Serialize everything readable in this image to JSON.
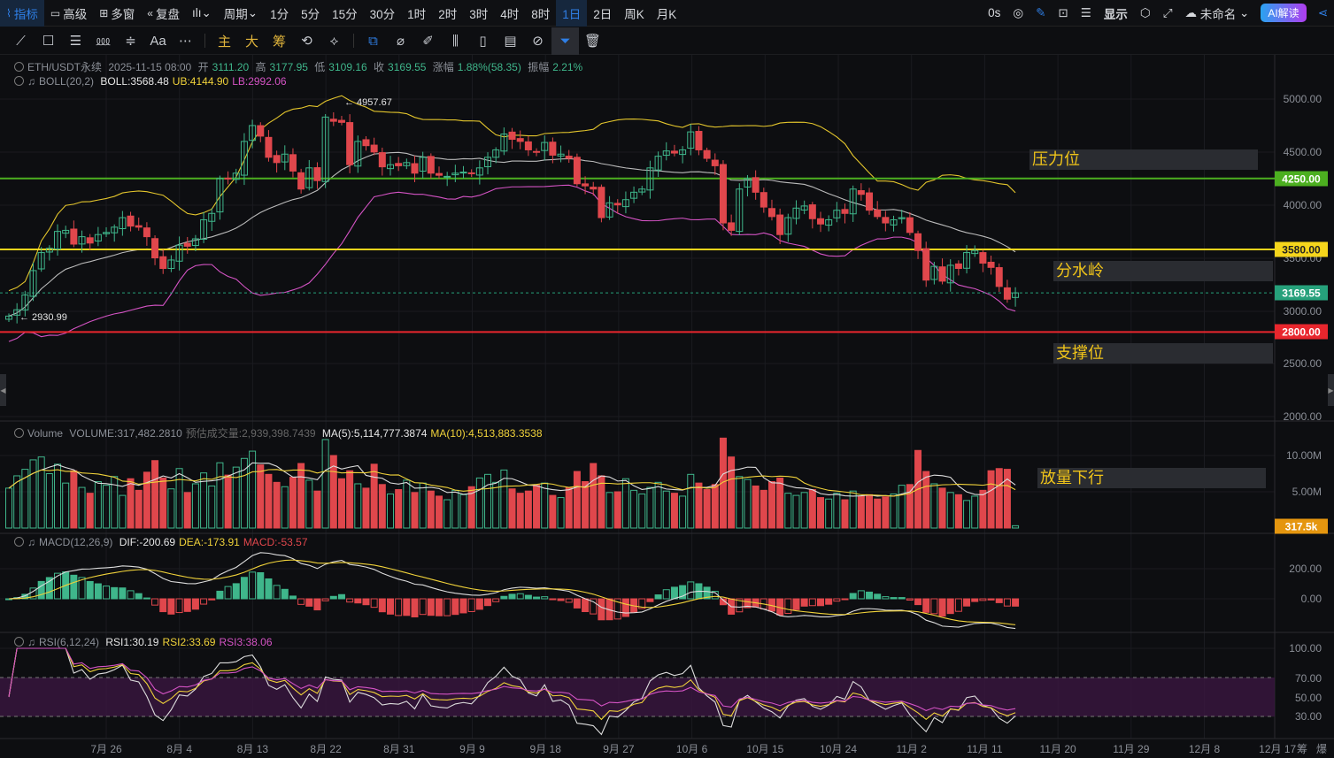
{
  "toolbar": {
    "indicators": "指标",
    "advanced": "高级",
    "multi_window": "多窗",
    "replay": "复盘",
    "period": "周期",
    "intervals": [
      "1分",
      "5分",
      "15分",
      "30分",
      "1时",
      "2时",
      "3时",
      "4时",
      "8时",
      "1日",
      "2日",
      "周K",
      "月K"
    ],
    "active_interval": "1日",
    "countdown": "0s",
    "display": "显示",
    "layout_name": "未命名",
    "ai_button": "AI解读"
  },
  "drawing_tools": {
    "text_tool": "Aa",
    "main": "主",
    "big": "大",
    "chips": "筹"
  },
  "info": {
    "symbol": "ETH/USDT永续",
    "datetime": "2025-11-15 08:00",
    "open_label": "开",
    "open": "3111.20",
    "high_label": "高",
    "high": "3177.95",
    "low_label": "低",
    "low": "3109.16",
    "close_label": "收",
    "close": "3169.55",
    "change_label": "涨幅",
    "change": "1.88%(58.35)",
    "amplitude_label": "振幅",
    "amplitude": "2.21%",
    "boll_name": "BOLL(20,2)",
    "boll": "BOLL:3568.48",
    "ub": "UB:4144.90",
    "lb": "LB:2992.06",
    "vol_name": "Volume",
    "volume": "VOLUME:317,482.2810",
    "est_volume": "预估成交量:2,939,398.7439",
    "vol_ma5": "MA(5):5,114,777.3874",
    "vol_ma10": "MA(10):4,513,883.3538",
    "macd_name": "MACD(12,26,9)",
    "dif": "DIF:-200.69",
    "dea": "DEA:-173.91",
    "macd": "MACD:-53.57",
    "rsi_name": "RSI(6,12,24)",
    "rsi1": "RSI1:30.19",
    "rsi2": "RSI2:33.69",
    "rsi3": "RSI3:38.06"
  },
  "markers": {
    "high": "← 4957.67",
    "low": "← 2930.99"
  },
  "annotations": {
    "resistance": "压力位",
    "watershed": "分水岭",
    "support": "支撑位",
    "volume_down": "放量下行"
  },
  "price_axis": [
    "5000.00",
    "4500.00",
    "4000.00",
    "3500.00",
    "3000.00",
    "2500.00",
    "2000.00"
  ],
  "volume_axis": [
    "10.00M",
    "5.00M"
  ],
  "macd_axis": [
    "200.00",
    "0.00"
  ],
  "rsi_axis": [
    "100.00",
    "70.00",
    "50.00",
    "30.00"
  ],
  "tags": {
    "resistance": "4250.00",
    "watershed": "3580.00",
    "last": "3169.55",
    "support": "2800.00",
    "volume": "317.5k"
  },
  "x_axis": [
    "7月 26",
    "8月 4",
    "8月 13",
    "8月 22",
    "8月 31",
    "9月 9",
    "9月 18",
    "9月 27",
    "10月 6",
    "10月 15",
    "10月 24",
    "11月 2",
    "11月 11",
    "11月 20",
    "11月 29",
    "12月 8",
    "12月 17"
  ],
  "x_axis_extra": [
    "筹",
    "爆"
  ],
  "colors": {
    "up": "#3fb68b",
    "down": "#e0474c",
    "resistance": "#4caf20",
    "watershed": "#f5d51c",
    "support": "#e8262d",
    "last": "#26a17b",
    "vol_tag": "#e5960f"
  },
  "chart_data": {
    "type": "candlestick",
    "title": "ETH/USDT永续 1日",
    "start_date": "2025-07-14",
    "levels": {
      "resistance": 4250,
      "watershed": 3580,
      "support": 2800
    },
    "close": [
      2950,
      3010,
      3150,
      3380,
      3550,
      3590,
      3750,
      3760,
      3630,
      3700,
      3640,
      3720,
      3740,
      3790,
      3880,
      3800,
      3790,
      3700,
      3500,
      3400,
      3480,
      3620,
      3610,
      3680,
      3860,
      3920,
      4250,
      4250,
      4300,
      4600,
      4750,
      4650,
      4450,
      4400,
      4480,
      4320,
      4150,
      4350,
      4230,
      4830,
      4790,
      4780,
      4380,
      4600,
      4560,
      4500,
      4360,
      4380,
      4370,
      4400,
      4300,
      4450,
      4300,
      4280,
      4270,
      4300,
      4310,
      4300,
      4350,
      4450,
      4520,
      4670,
      4620,
      4600,
      4520,
      4500,
      4590,
      4470,
      4480,
      4440,
      4200,
      4180,
      4150,
      3880,
      4020,
      4000,
      4050,
      4120,
      4150,
      4350,
      4460,
      4510,
      4490,
      4520,
      4690,
      4520,
      4440,
      4370,
      3830,
      3760,
      4150,
      4250,
      4120,
      3980,
      3890,
      3720,
      3880,
      3970,
      3990,
      3870,
      3820,
      3860,
      3950,
      3920,
      4150,
      4100,
      3950,
      3890,
      3830,
      3860,
      3880,
      3740,
      3570,
      3290,
      3420,
      3280,
      3430,
      3400,
      3550,
      3570,
      3450,
      3410,
      3230,
      3110,
      3169.55
    ],
    "volume_m": [
      5.5,
      7.2,
      8.1,
      9.4,
      9.8,
      7.5,
      8.8,
      6.2,
      7.9,
      5.6,
      4.8,
      6.4,
      5.9,
      7.1,
      4.5,
      6.8,
      5.2,
      7.7,
      9.3,
      6.9,
      5.4,
      8.2,
      4.9,
      6.1,
      7.6,
      5.8,
      9.0,
      7.3,
      8.4,
      9.6,
      10.6,
      8.7,
      7.4,
      6.3,
      5.7,
      7.0,
      8.9,
      6.6,
      5.1,
      12.2,
      10.0,
      6.8,
      7.9,
      6.1,
      5.5,
      8.8,
      6.0,
      4.7,
      5.3,
      6.6,
      4.9,
      6.2,
      5.1,
      4.4,
      3.9,
      5.2,
      4.6,
      5.7,
      6.9,
      7.4,
      6.3,
      8.0,
      5.4,
      4.8,
      5.1,
      5.9,
      6.2,
      4.5,
      4.2,
      5.6,
      7.8,
      6.4,
      8.9,
      7.2,
      4.9,
      5.0,
      6.8,
      5.2,
      4.7,
      5.6,
      6.3,
      5.1,
      4.8,
      4.4,
      7.4,
      6.2,
      5.3,
      6.0,
      12.4,
      9.8,
      7.1,
      6.7,
      5.8,
      5.2,
      6.4,
      6.9,
      4.8,
      4.5,
      4.9,
      5.3,
      4.2,
      4.0,
      4.8,
      3.9,
      5.1,
      4.4,
      4.6,
      4.0,
      4.3,
      4.7,
      5.9,
      6.0,
      10.7,
      7.8,
      6.1,
      5.5,
      4.9,
      4.6,
      3.8,
      4.4,
      5.2,
      7.9,
      8.2,
      8.1,
      0.32
    ]
  }
}
